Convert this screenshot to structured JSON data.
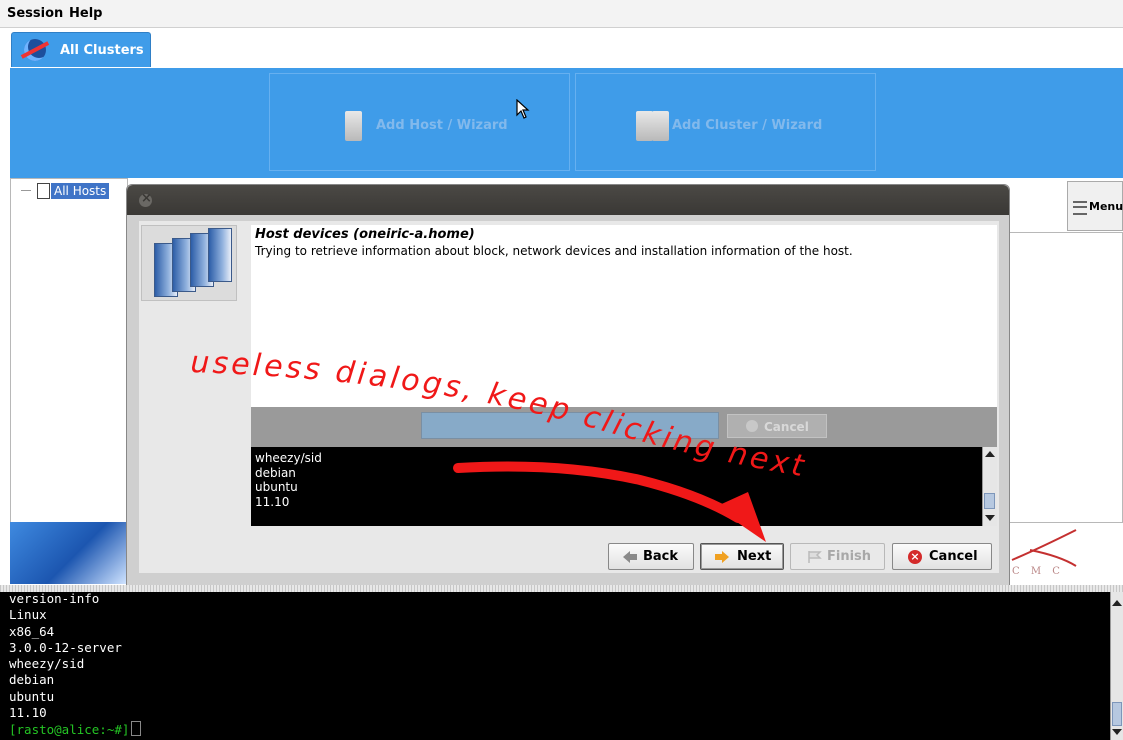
{
  "menubar": {
    "items": [
      {
        "label": "Session",
        "accel": "S"
      },
      {
        "label": "Help",
        "accel": "H"
      }
    ]
  },
  "tab": {
    "label": "All Clusters"
  },
  "toolbar": {
    "add_host_label": "Add Host / Wizard",
    "add_cluster_label": "Add Cluster / Wizard"
  },
  "tree": {
    "root_label": "All Hosts"
  },
  "right_menu": {
    "label": "Menu"
  },
  "logo": {
    "text": "C M C"
  },
  "dialog": {
    "title": "Host devices (oneiric-a.home)",
    "description": "Trying to retrieve information about block, network devices and installation information of the host.",
    "progress_cancel_label": "Cancel",
    "output_lines": [
      "wheezy/sid",
      "debian",
      "ubuntu",
      "11.10"
    ],
    "buttons": {
      "back": "Back",
      "next": "Next",
      "finish": "Finish",
      "cancel": "Cancel"
    }
  },
  "terminal": {
    "lines": [
      "version-info",
      "Linux",
      "x86_64",
      "3.0.0-12-server",
      "wheezy/sid",
      "debian",
      "ubuntu",
      "11.10"
    ],
    "prompt": "[rasto@alice:~#]"
  },
  "annotation": {
    "line1": "useless dialogs, keep clicking next",
    "color": "#f01818"
  },
  "colors": {
    "accent": "#3f9ce9",
    "dialog_titlebar": "#3a3835",
    "prompt": "#24c424"
  }
}
